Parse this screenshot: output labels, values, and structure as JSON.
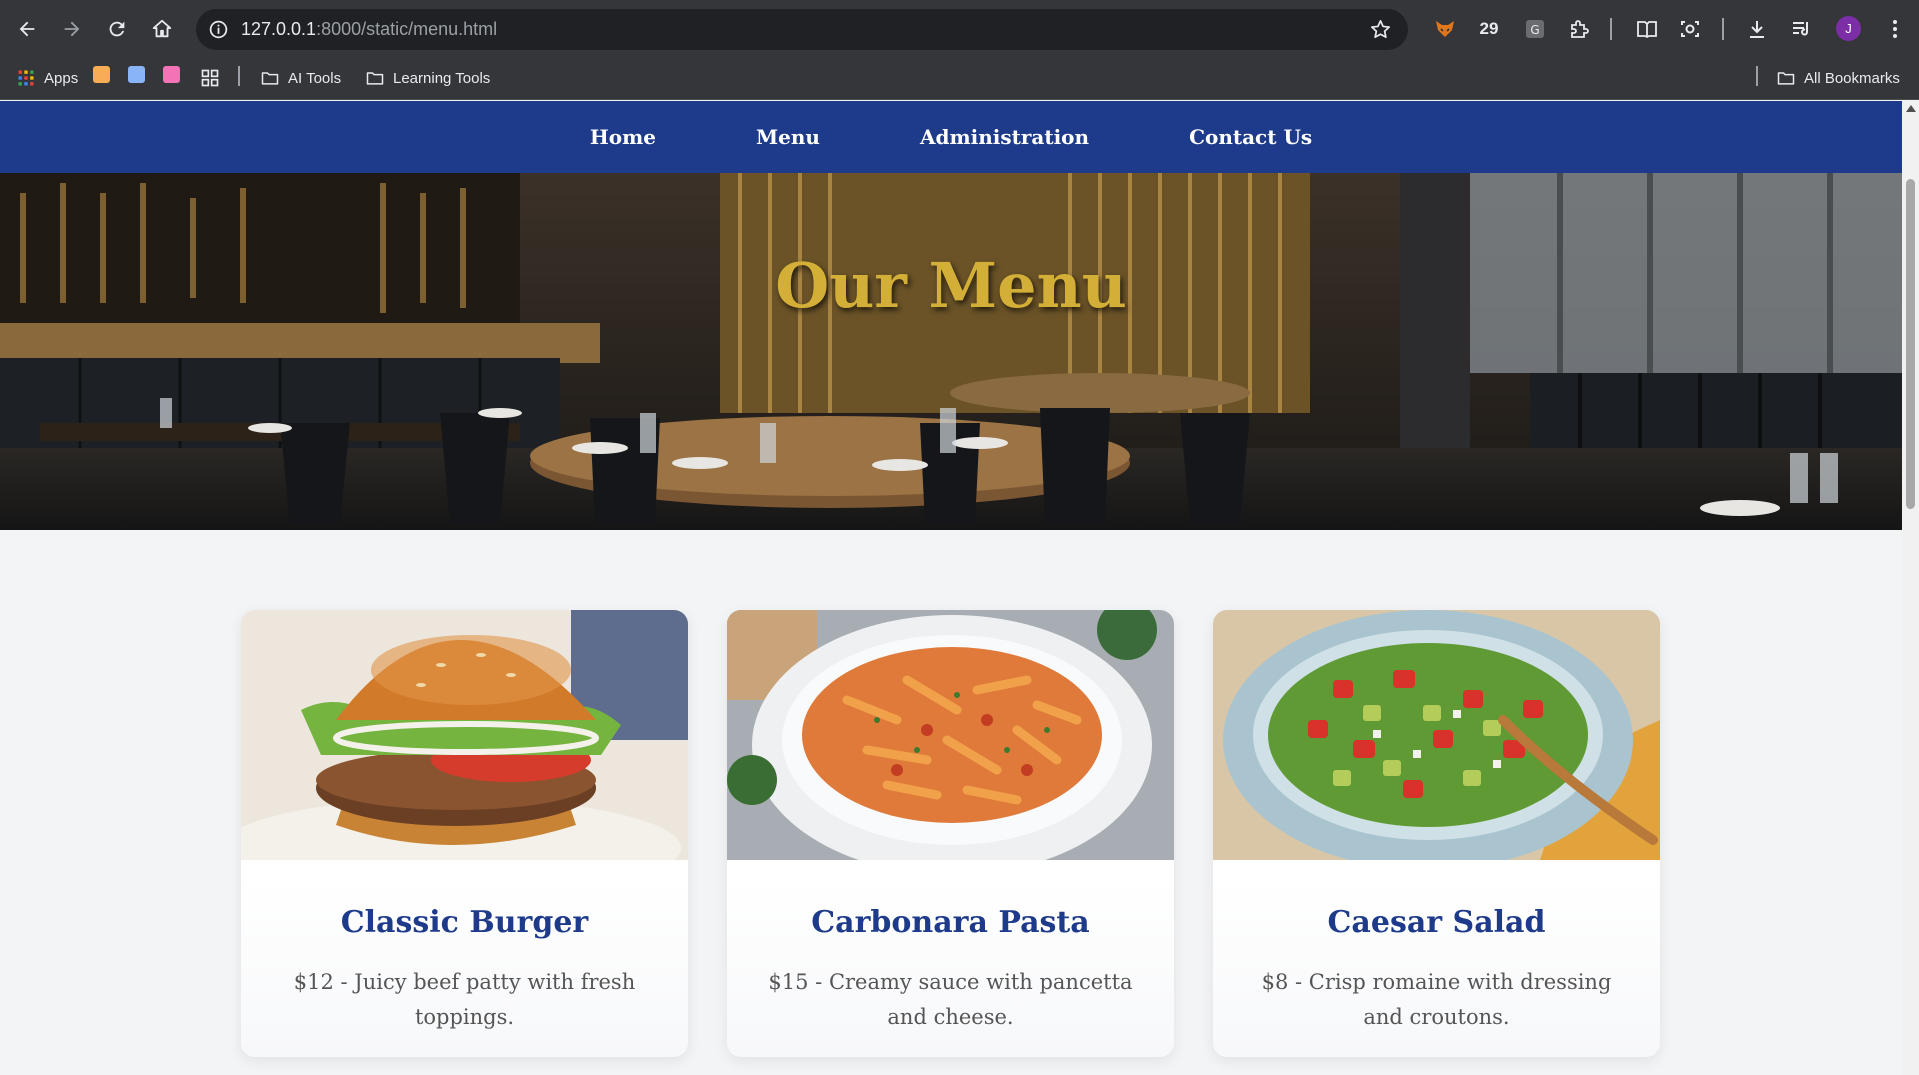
{
  "browser": {
    "url_host": "127.0.0.1",
    "url_rest": ":8000/static/menu.html",
    "extension_count": "29",
    "profile_initial": "J",
    "bookmarks": {
      "apps_label": "Apps",
      "folder_1": "AI Tools",
      "folder_2": "Learning Tools",
      "all_bookmarks": "All Bookmarks"
    },
    "icons": [
      "back-icon",
      "forward-icon",
      "reload-icon",
      "home-icon",
      "site-info-icon",
      "star-icon",
      "fox-extension-icon",
      "g-extension-icon",
      "puzzle-icon",
      "reading-mode-icon",
      "screenshot-icon",
      "download-icon",
      "media-icon",
      "more-icon"
    ]
  },
  "nav": {
    "home": "Home",
    "menu": "Menu",
    "administration": "Administration",
    "contact": "Contact Us"
  },
  "hero": {
    "title": "Our Menu"
  },
  "menu_items": [
    {
      "name": "Classic Burger",
      "description": "$12 - Juicy beef patty with fresh toppings."
    },
    {
      "name": "Carbonara Pasta",
      "description": "$15 - Creamy sauce with pancetta and cheese."
    },
    {
      "name": "Caesar Salad",
      "description": "$8 - Crisp romaine with dressing and croutons."
    }
  ],
  "colors": {
    "nav_bg": "#1e3a8a",
    "title_gold": "#d4af37",
    "card_title": "#1e3a8a",
    "page_bg": "#f3f4f6"
  }
}
